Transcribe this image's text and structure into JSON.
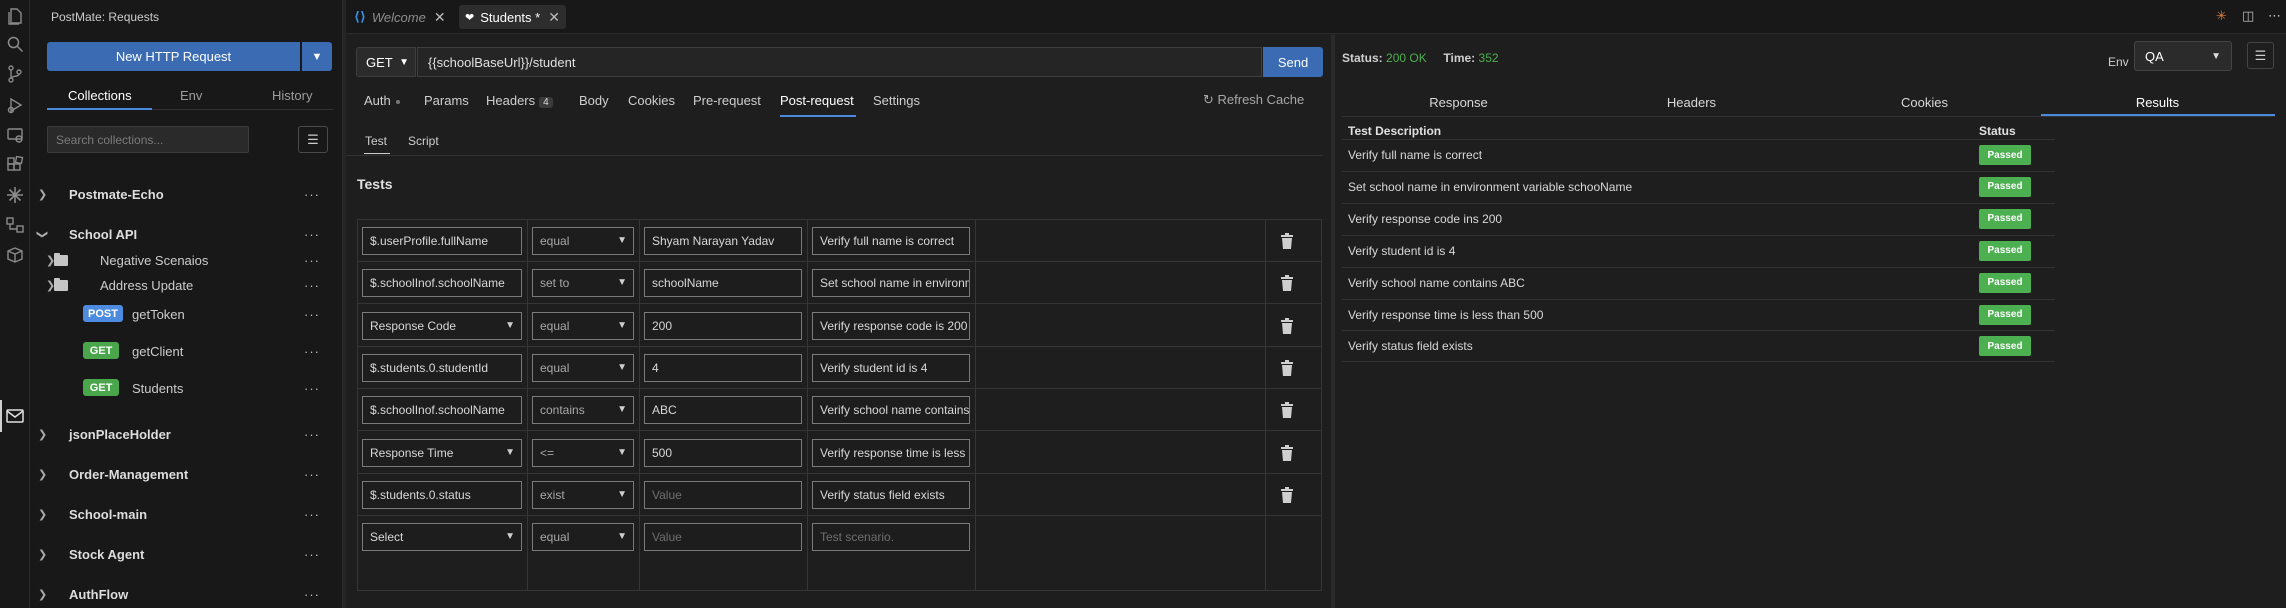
{
  "sidebar": {
    "title": "PostMate: Requests",
    "new_request_label": "New HTTP Request",
    "tabs": [
      {
        "label": "Collections",
        "active": true
      },
      {
        "label": "Env",
        "active": false
      },
      {
        "label": "History",
        "active": false
      }
    ],
    "search_placeholder": "Search collections...",
    "tree": [
      {
        "label": "Postmate-Echo",
        "kind": "collection",
        "expanded": false
      },
      {
        "label": "School API",
        "kind": "collection",
        "expanded": true
      },
      {
        "label": "Negative Scenaios",
        "kind": "folder"
      },
      {
        "label": "Address Update",
        "kind": "folder"
      },
      {
        "label": "getToken",
        "kind": "request",
        "method": "POST"
      },
      {
        "label": "getClient",
        "kind": "request",
        "method": "GET"
      },
      {
        "label": "Students",
        "kind": "request",
        "method": "GET"
      },
      {
        "label": "jsonPlaceHolder",
        "kind": "collection",
        "expanded": false
      },
      {
        "label": "Order-Management",
        "kind": "collection",
        "expanded": false
      },
      {
        "label": "School-main",
        "kind": "collection",
        "expanded": false
      },
      {
        "label": "Stock Agent",
        "kind": "collection",
        "expanded": false
      },
      {
        "label": "AuthFlow",
        "kind": "collection",
        "expanded": false
      }
    ]
  },
  "editor_tabs": [
    {
      "label": "Welcome",
      "active": false
    },
    {
      "label": "Students *",
      "active": true
    }
  ],
  "request": {
    "method": "GET",
    "url": "{{schoolBaseUrl}}/student",
    "send_label": "Send",
    "tabs": [
      {
        "label": "Auth"
      },
      {
        "label": "Params"
      },
      {
        "label": "Headers",
        "badge": "4"
      },
      {
        "label": "Body"
      },
      {
        "label": "Cookies"
      },
      {
        "label": "Pre-request"
      },
      {
        "label": "Post-request",
        "active": true
      },
      {
        "label": "Settings"
      }
    ],
    "refresh_cache_label": "Refresh Cache",
    "sub_tabs": [
      {
        "label": "Test",
        "active": true
      },
      {
        "label": "Script"
      }
    ],
    "tests_title": "Tests",
    "tests": [
      {
        "property": "$.userProfile.fullName",
        "property_is_select": false,
        "operator": "equal",
        "value": "Shyam Narayan Yadav",
        "description": "Verify full name is correct",
        "deletable": true
      },
      {
        "property": "$.schoolInof.schoolName",
        "property_is_select": false,
        "operator": "set to",
        "value": "schoolName",
        "description": "Set school name in environment variable schooName",
        "deletable": true
      },
      {
        "property": "Response Code",
        "property_is_select": true,
        "operator": "equal",
        "value": "200",
        "description": "Verify response code is 200",
        "deletable": true
      },
      {
        "property": "$.students.0.studentId",
        "property_is_select": false,
        "operator": "equal",
        "value": "4",
        "description": "Verify student id is 4",
        "deletable": true
      },
      {
        "property": "$.schoolInof.schoolName",
        "property_is_select": false,
        "operator": "contains",
        "value": "ABC",
        "description": "Verify school name contains ABC",
        "deletable": true
      },
      {
        "property": "Response Time",
        "property_is_select": true,
        "operator": "<=",
        "value": "500",
        "description": "Verify response time is less than 500",
        "deletable": true
      },
      {
        "property": "$.students.0.status",
        "property_is_select": false,
        "operator": "exist",
        "value": "",
        "value_placeholder": "Value",
        "description": "Verify status field exists",
        "deletable": true
      },
      {
        "property": "Select",
        "property_is_select": true,
        "operator": "equal",
        "value": "",
        "value_placeholder": "Value",
        "description": "",
        "description_placeholder": "Test scenario.",
        "deletable": false
      }
    ]
  },
  "response": {
    "status_label": "Status:",
    "status_value": "200 OK",
    "time_label": "Time:",
    "time_value": "352",
    "env_label": "Env",
    "env_value": "QA",
    "tabs": [
      {
        "label": "Response"
      },
      {
        "label": "Headers"
      },
      {
        "label": "Cookies"
      },
      {
        "label": "Results",
        "active": true
      }
    ],
    "results_headers": {
      "description": "Test Description",
      "status": "Status"
    },
    "results": [
      {
        "description": "Verify full name is correct",
        "status": "Passed"
      },
      {
        "description": "Set school name in environment variable schooName",
        "status": "Passed"
      },
      {
        "description": "Verify response code ins 200",
        "status": "Passed"
      },
      {
        "description": "Verify student id is 4",
        "status": "Passed"
      },
      {
        "description": "Verify school name contains ABC",
        "status": "Passed"
      },
      {
        "description": "Verify response time is less than 500",
        "status": "Passed"
      },
      {
        "description": "Verify status field exists",
        "status": "Passed"
      }
    ]
  },
  "colors": {
    "accent": "#3a6bb3",
    "success": "#4caf50",
    "method_post": "#4c8be0",
    "method_get": "#4aa64a"
  }
}
